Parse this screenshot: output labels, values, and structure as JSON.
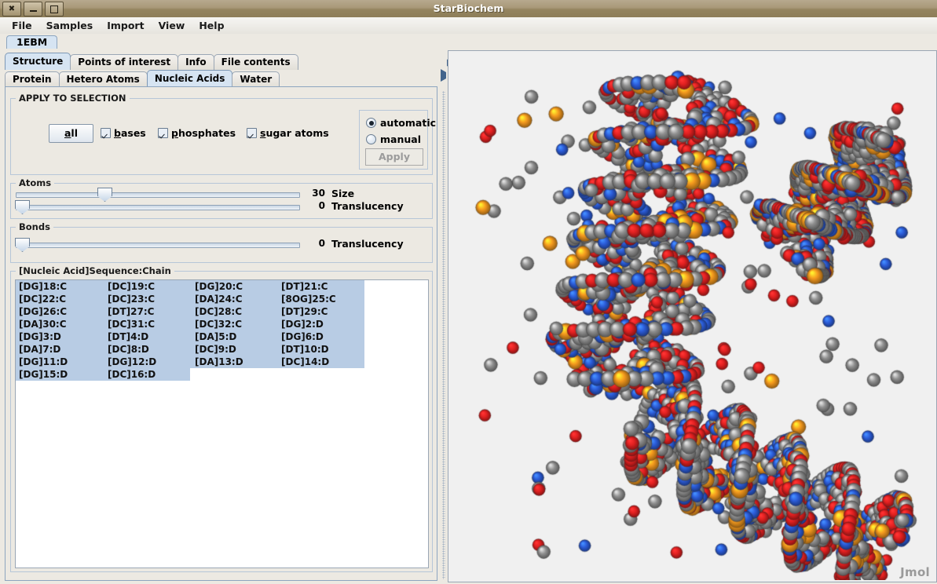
{
  "window": {
    "title": "StarBiochem",
    "buttons": [
      {
        "name": "close-button",
        "glyph": "✖"
      },
      {
        "name": "minimize-button",
        "glyph": "–"
      },
      {
        "name": "maximize-button",
        "glyph": "□"
      }
    ]
  },
  "menubar": {
    "items": [
      "File",
      "Samples",
      "Import",
      "View",
      "Help"
    ]
  },
  "document_tabs": {
    "items": [
      {
        "label": "1EBM",
        "selected": true
      }
    ]
  },
  "main_tabs": {
    "items": [
      {
        "label": "Structure",
        "selected": true
      },
      {
        "label": "Points of interest",
        "selected": false
      },
      {
        "label": "Info",
        "selected": false
      },
      {
        "label": "File contents",
        "selected": false
      }
    ]
  },
  "sub_tabs": {
    "items": [
      {
        "label": "Protein",
        "selected": false
      },
      {
        "label": "Hetero Atoms",
        "selected": false
      },
      {
        "label": "Nucleic Acids",
        "selected": true
      },
      {
        "label": "Water",
        "selected": false
      }
    ]
  },
  "apply_to_selection": {
    "title": "APPLY TO SELECTION",
    "all_button": {
      "label": "all",
      "mnemonic": "a"
    },
    "checkboxes": [
      {
        "label": "bases",
        "mnemonic": "b",
        "checked": true
      },
      {
        "label": "phosphates",
        "mnemonic": "p",
        "checked": true
      },
      {
        "label": "sugar atoms",
        "mnemonic": "s",
        "checked": true
      }
    ],
    "mode": {
      "options": [
        {
          "label": "automatic",
          "selected": true
        },
        {
          "label": "manual",
          "selected": false
        }
      ],
      "apply_button": {
        "label": "Apply",
        "enabled": false
      }
    }
  },
  "atoms_group": {
    "title": "Atoms",
    "sliders": [
      {
        "label": "Size",
        "value": "30",
        "percent": 31
      },
      {
        "label": "Translucency",
        "value": "0",
        "percent": 0
      }
    ]
  },
  "bonds_group": {
    "title": "Bonds",
    "sliders": [
      {
        "label": "Translucency",
        "value": "0",
        "percent": 0
      }
    ]
  },
  "nucleic_list": {
    "title": "[Nucleic Acid]Sequence:Chain",
    "rows": [
      [
        "[DG]18:C",
        "[DC]19:C",
        "[DG]20:C",
        "[DT]21:C"
      ],
      [
        "[DC]22:C",
        "[DC]23:C",
        "[DA]24:C",
        "[8OG]25:C"
      ],
      [
        "[DG]26:C",
        "[DT]27:C",
        "[DC]28:C",
        "[DT]29:C"
      ],
      [
        "[DA]30:C",
        "[DC]31:C",
        "[DC]32:C",
        "[DG]2:D"
      ],
      [
        "[DG]3:D",
        "[DT]4:D",
        "[DA]5:D",
        "[DG]6:D"
      ],
      [
        "[DA]7:D",
        "[DC]8:D",
        "[DC]9:D",
        "[DT]10:D"
      ],
      [
        "[DG]11:D",
        "[DG]12:D",
        "[DA]13:D",
        "[DC]14:D"
      ],
      [
        "[DG]15:D",
        "[DC]16:D"
      ]
    ],
    "selection_color": "#b8cce4",
    "all_selected": true
  },
  "viewer": {
    "watermark": "Jmol",
    "background": "#f0f0f0",
    "atom_colors": {
      "carbon": "#909090",
      "oxygen": "#e02020",
      "nitrogen": "#2b5bd7",
      "phosphorus": "#f59a1e"
    },
    "molecule": "DNA duplex with 8-oxoguanine lesion, ball-and-stick CPK rendering"
  }
}
